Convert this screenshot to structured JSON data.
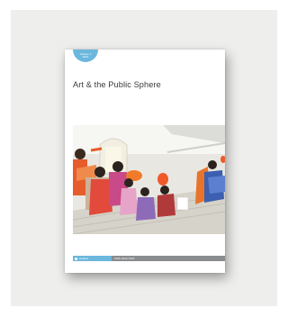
{
  "journal": {
    "title": "Art & the Public Sphere",
    "badge_line1": "Volume 1",
    "badge_line2": "2021"
  },
  "footer": {
    "publisher": "intellect",
    "extra": "ISSN 2042-793X"
  },
  "colors": {
    "panel": "#eeeeec",
    "accent": "#6cb7dd",
    "footer_gray": "#8a8c8e"
  }
}
